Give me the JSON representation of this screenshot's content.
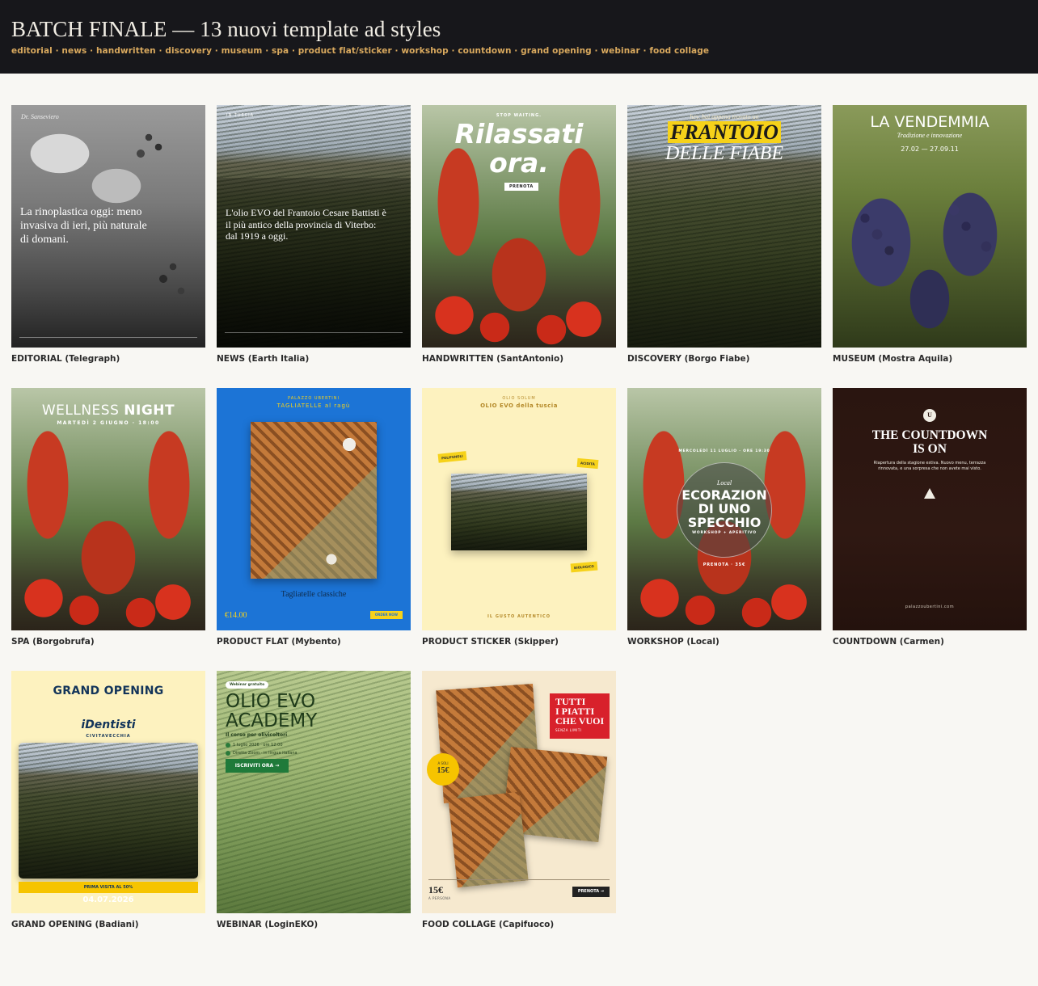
{
  "header": {
    "title": "BATCH FINALE — 13 nuovi template ad styles",
    "tags": "editorial · news · handwritten · discovery · museum · spa · product flat/sticker · workshop · countdown · grand opening · webinar · food collage"
  },
  "cards": {
    "editorial": {
      "caption": "EDITORIAL (Telegraph)",
      "brand": "Dr. Sanseviero",
      "headline": "La rinoplastica oggi: meno invasiva di ieri, più naturale di domani."
    },
    "news": {
      "caption": "NEWS (Earth Italia)",
      "kicker": "IN TUSCIA",
      "headline": "L'olio EVO del Frantoio Cesare Battisti è il più antico della provincia di Viterbo: dal 1919 a oggi."
    },
    "handwritten": {
      "caption": "HANDWRITTEN (SantAntonio)",
      "kicker": "STOP WAITING.",
      "headline1": "Rilassati",
      "headline2": "ora.",
      "cta": "PRENOTA"
    },
    "discovery": {
      "caption": "DISCOVERY (Borgo Fiabe)",
      "kicker": "hey, hai appena trovato un",
      "headline1": "FRANTOIO",
      "headline2": "DELLE FIABE"
    },
    "museum": {
      "caption": "MUSEUM (Mostra Aquila)",
      "headline": "LA VENDEMMIA",
      "subtitle": "Tradizione e innovazione",
      "dates": "27.02 — 27.09.11"
    },
    "spa": {
      "caption": "SPA (Borgobrufa)",
      "headline1": "WELLNESS",
      "headline2": "NIGHT",
      "date": "MARTEDÌ 2 GIUGNO · 18:00"
    },
    "product_flat": {
      "caption": "PRODUCT FLAT (Mybento)",
      "kicker": "PALAZZO UBERTINI",
      "title": "TAGLIATELLE al ragù",
      "name": "Tagliatelle classiche",
      "price": "€14.00",
      "cta": "ORDER NOW"
    },
    "product_sticker": {
      "caption": "PRODUCT STICKER (Skipper)",
      "kicker": "OLIO SOLUM",
      "title": "OLIO EVO della tuscia",
      "sticker1": "POLIFENOLI",
      "sticker2": "ACIDITÀ",
      "sticker3": "BIOLOGICO",
      "footer": "IL GUSTO AUTENTICO"
    },
    "workshop": {
      "caption": "WORKSHOP (Local)",
      "date": "MERCOLEDÌ 11 LUGLIO · ORE 19:30",
      "brand": "Local",
      "headline1": "ECORAZION",
      "headline2": "DI UNO",
      "headline3": "SPECCHIO",
      "subtitle": "WORKSHOP + APERITIVO",
      "price": "PRENOTA · 35€"
    },
    "countdown": {
      "caption": "COUNTDOWN (Carmen)",
      "logo": "U",
      "headline1": "THE COUNTDOWN",
      "headline2": "IS ON",
      "body": "Riapertura della stagione estiva. Nuovo menu, terrazza rinnovata, e una sorpresa che non avete mai visto.",
      "footer": "palazzoubertini.com"
    },
    "grand_opening": {
      "caption": "GRAND OPENING (Badiani)",
      "headline": "GRAND OPENING",
      "brand": "iDentisti",
      "city": "CIVITAVECCHIA",
      "offer": "PRIMA VISITA AL 50%",
      "date": "04.07.2026"
    },
    "webinar": {
      "caption": "WEBINAR (LoginEKO)",
      "badge": "Webinar gratuito",
      "headline1": "OLIO EVO",
      "headline2": "ACADEMY",
      "subtitle": "Il corso per olivicoltori",
      "bullet1": "1 luglio 2026 · ore 12:00",
      "bullet2": "Diretta Zoom · in lingua italiana",
      "cta": "ISCRIVITI ORA →"
    },
    "food_collage": {
      "caption": "FOOD COLLAGE (Capifuoco)",
      "headline1": "TUTTI",
      "headline2": "I PIATTI",
      "headline3": "CHE VUOI",
      "subtitle": "SENZA LIMITI",
      "badge_small": "A SOLI",
      "badge_price": "15€",
      "price": "15€",
      "per": "A PERSONA",
      "cta": "PRENOTA →"
    }
  }
}
